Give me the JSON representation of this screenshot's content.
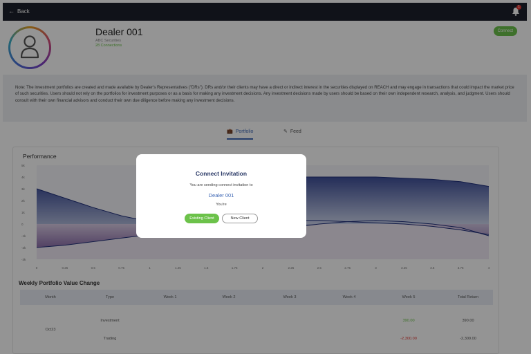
{
  "topbar": {
    "back_label": "Back",
    "notifications_count": "1"
  },
  "profile": {
    "name": "Dealer 001",
    "firm": "ABC Securities",
    "connections": "28 Connections",
    "connect_label": "Connect"
  },
  "note": "Note: The investment portfolios are created and made available by Dealer's Representatives (\"DRs\"). DRs and/or their clients may have a direct or indirect interest in the securities displayed on REACH and may engage in transactions that could impact the market price of such securities. Users should not rely on the portfolios for investment purposes or as a basis for making any investment decisions. Any investment decisions made by users should be based on their own independent research, analysis, and judgment. Users should consult with their own financial advisors and conduct their own due diligence before making any investment decisions.",
  "tabs": {
    "portfolio": "Portfolio",
    "feed": "Feed"
  },
  "performance": {
    "title": "Performance"
  },
  "chart_data": {
    "type": "area",
    "title": "Performance",
    "x": [
      0,
      0.25,
      0.5,
      0.75,
      1,
      1.25,
      1.5,
      1.75,
      2,
      2.25,
      2.5,
      2.75,
      3,
      3.25,
      3.5,
      3.75,
      4
    ],
    "xticks": [
      "0",
      "0.25",
      "0.5",
      "0.75",
      "1",
      "1.25",
      "1.5",
      "1.75",
      "2",
      "2.25",
      "2.5",
      "2.75",
      "3",
      "3.25",
      "3.5",
      "3.75",
      "4"
    ],
    "yticks": [
      "-3k",
      "-2k",
      "-1k",
      "0",
      "1k",
      "2k",
      "3k",
      "4k",
      "5k"
    ],
    "ylim": [
      -3000,
      5000
    ],
    "series": [
      {
        "values": [
          3000,
          2200,
          1400,
          700,
          200,
          0,
          -200,
          -400,
          -400,
          -300,
          0,
          200,
          300,
          200,
          0,
          -300,
          -1000
        ]
      },
      {
        "values": [
          -2000,
          -1800,
          -1500,
          -1200,
          -900,
          -600,
          -300,
          0,
          200,
          300,
          300,
          200,
          100,
          0,
          -200,
          -500,
          -900
        ]
      },
      {
        "values": [
          0,
          0,
          0,
          0,
          0,
          0,
          0,
          0,
          4000,
          4000,
          4000,
          4000,
          4000,
          3900,
          3800,
          3600,
          3200
        ]
      }
    ]
  },
  "weekly": {
    "title": "Weekly Portfolio Value Change",
    "headers": [
      "Month",
      "Type",
      "Week 1",
      "Week 2",
      "Week 3",
      "Week 4",
      "Week 5",
      "Total Return"
    ],
    "month": "Oct23",
    "rows": [
      {
        "type": "Investment",
        "week5": "390.00",
        "total": "390.00"
      },
      {
        "type": "Trading",
        "week5": "-2,300.00",
        "total": "-2,300.00"
      }
    ]
  },
  "modal": {
    "title": "Connect Invitation",
    "subtitle": "You are sending connect invitation to",
    "dealer": "Dealer 001",
    "youre": "You're",
    "existing_label": "Existing Client",
    "new_label": "New Client"
  },
  "colors": {
    "accent": "#6cc24a",
    "link": "#3f68b5",
    "topbar": "#1c1f2b",
    "negative": "#e53935"
  }
}
